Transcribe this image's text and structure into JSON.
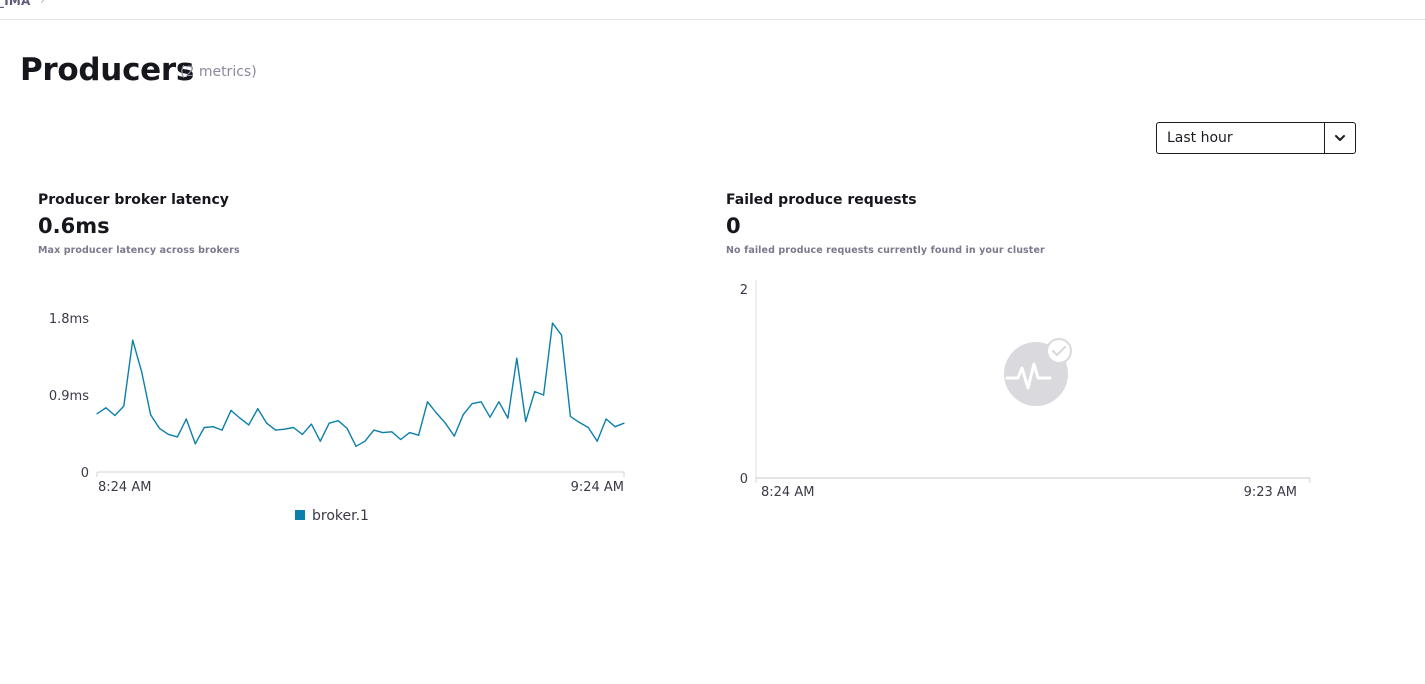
{
  "breadcrumb": {
    "label": "_IMA",
    "separator": "›"
  },
  "page": {
    "title": "Producers",
    "subtitle": "(2 metrics)"
  },
  "time_range": {
    "selected": "Last hour"
  },
  "cards": [
    {
      "title": "Producer broker latency",
      "value": "0.6ms",
      "description": "Max producer latency across brokers"
    },
    {
      "title": "Failed produce requests",
      "value": "0",
      "description": "No failed produce requests currently found in your cluster",
      "empty_state_icon": "heartbeat-check-icon"
    }
  ],
  "chart_data": [
    {
      "type": "line",
      "y_ticks": [
        "1.8ms",
        "0.9ms",
        "0"
      ],
      "x_ticks": [
        "8:24 AM",
        "9:24 AM"
      ],
      "ylim": [
        0,
        1.8
      ],
      "series": [
        {
          "name": "broker.1",
          "color": "#0b7fab",
          "values": [
            0.68,
            0.75,
            0.66,
            0.77,
            1.54,
            1.17,
            0.67,
            0.51,
            0.44,
            0.41,
            0.62,
            0.33,
            0.52,
            0.53,
            0.49,
            0.72,
            0.63,
            0.55,
            0.74,
            0.57,
            0.49,
            0.5,
            0.52,
            0.44,
            0.56,
            0.36,
            0.57,
            0.6,
            0.51,
            0.3,
            0.36,
            0.49,
            0.46,
            0.47,
            0.38,
            0.46,
            0.43,
            0.82,
            0.69,
            0.57,
            0.42,
            0.67,
            0.8,
            0.82,
            0.64,
            0.82,
            0.63,
            1.33,
            0.59,
            0.94,
            0.9,
            1.74,
            1.6,
            0.65,
            0.58,
            0.52,
            0.36,
            0.62,
            0.53,
            0.57
          ]
        }
      ]
    },
    {
      "type": "line",
      "y_ticks": [
        "2",
        "0"
      ],
      "x_ticks": [
        "8:24 AM",
        "9:23 AM"
      ],
      "ylim": [
        0,
        2
      ],
      "series": []
    }
  ]
}
